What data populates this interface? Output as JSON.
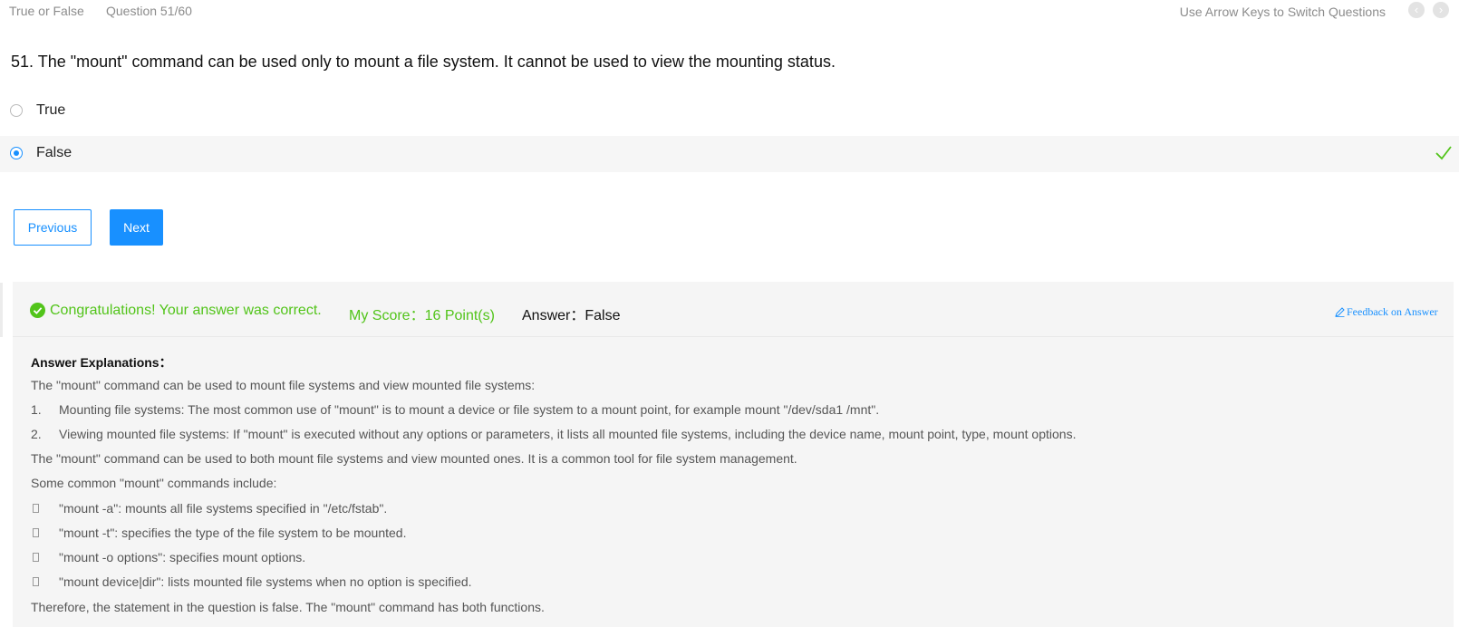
{
  "header": {
    "question_type": "True or False",
    "question_counter": "Question 51/60",
    "nav_hint": "Use Arrow Keys to Switch Questions",
    "prev_glyph": "‹",
    "next_glyph": "›"
  },
  "question": {
    "text": "51. The \"mount\" command can be used only to mount a file system. It cannot be used to view the mounting status."
  },
  "options": [
    {
      "label": "True",
      "selected": false
    },
    {
      "label": "False",
      "selected": true,
      "correct_mark": "check-icon"
    }
  ],
  "buttons": {
    "previous": "Previous",
    "next": "Next"
  },
  "result": {
    "congrats": "Congratulations! Your answer was correct.",
    "score": "My Score：16 Point(s)",
    "answer": "Answer：False",
    "feedback_link": "Feedback on Answer"
  },
  "explanation": {
    "heading": "Answer Explanations：",
    "intro": "The \"mount\" command can be used to mount file systems and view mounted file systems:",
    "numbered": [
      {
        "num": "1.",
        "text": "Mounting file systems: The most common use of \"mount\" is to mount a device or file system to a mount point, for example mount \"/dev/sda1 /mnt\"."
      },
      {
        "num": "2.",
        "text": "Viewing mounted file systems: If \"mount\" is executed without any options or parameters, it lists all mounted file systems, including the device name, mount point, type, mount options."
      }
    ],
    "summary": "The \"mount\" command can be used to both mount file systems and view mounted ones. It is a common tool for file system management.",
    "commands_intro": "Some common \"mount\" commands include:",
    "commands": [
      "\"mount -a\": mounts all file systems specified in \"/etc/fstab\".",
      "\"mount -t\": specifies the type of the file system to be mounted.",
      "\"mount -o options\": specifies mount options.",
      "\"mount device|dir\": lists mounted file systems when no option is specified."
    ],
    "conclusion": "Therefore, the statement in the question is false. The \"mount\" command has both functions."
  },
  "colors": {
    "accent": "#1890ff",
    "success": "#52c41a",
    "muted": "#8c8c8c"
  }
}
